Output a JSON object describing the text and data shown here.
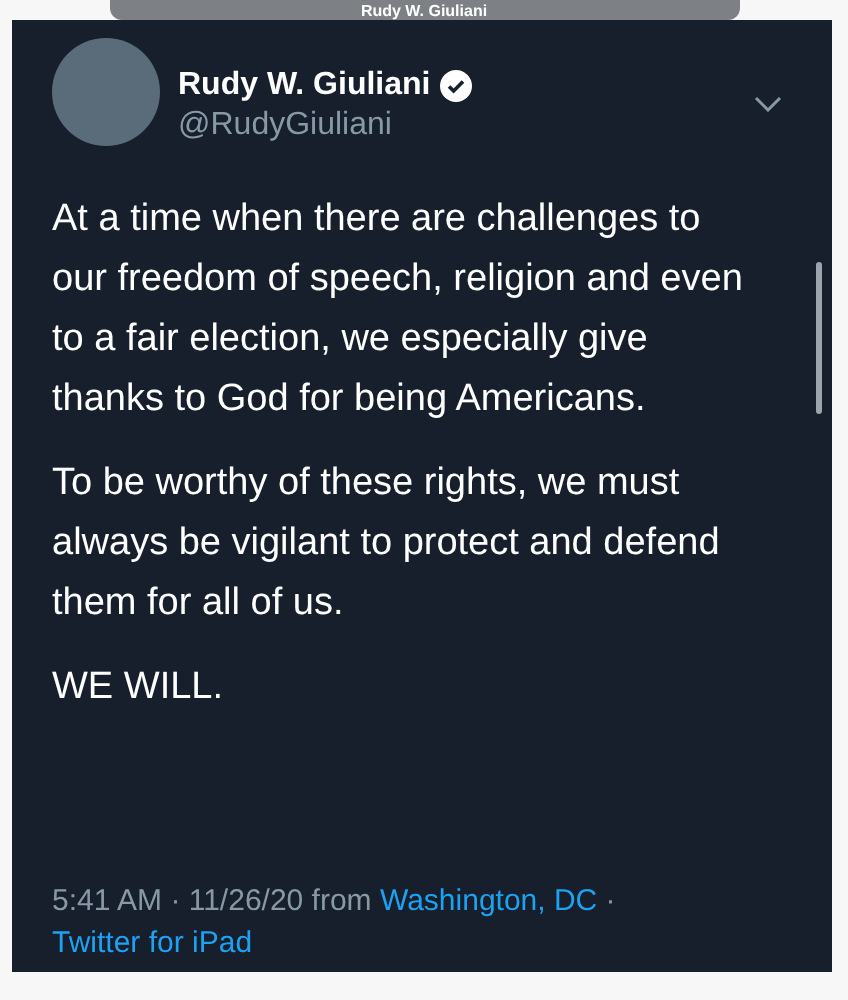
{
  "behind_header": {
    "name": "Rudy W. Giuliani"
  },
  "tweet": {
    "name": "Rudy W. Giuliani",
    "verified": true,
    "handle": "@RudyGiuliani",
    "paragraphs": [
      "At a time when there are challenges to our freedom of speech, religion and even to a fair election, we especially give thanks to God for being Americans.",
      "To be worthy of these rights, we must always be vigilant to protect and defend them for all of us.",
      "WE WILL."
    ],
    "meta": [
      {
        "kind": "text",
        "text": "5:41 AM · 11/26/20 from "
      },
      {
        "kind": "link",
        "text": "Washington, DC"
      },
      {
        "kind": "text",
        "text": " · "
      },
      {
        "kind": "link",
        "text": "Twitter for iPad"
      }
    ]
  }
}
